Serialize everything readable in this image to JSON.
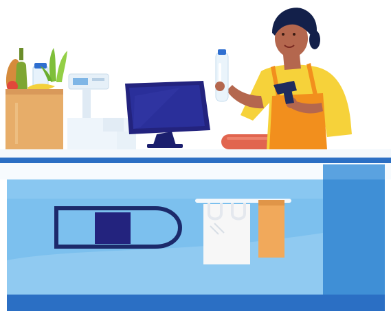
{
  "scene": {
    "subject": "cashier-at-checkout-counter",
    "colors": {
      "counter_body": "#7cc0ee",
      "counter_body_light": "#a9d6f5",
      "counter_side": "#3f8fd6",
      "counter_top": "#f3f8fc",
      "counter_edge": "#2b6fc4",
      "monitor": "#23237e",
      "monitor_screen": "#2a2f9a",
      "apron": "#f28f1d",
      "shirt": "#f6d23a",
      "skin": "#b4674e",
      "hair": "#13204a",
      "paper_bag": "#e7ad69",
      "bread": "#d58b3c",
      "milk_bottle": "#eaf4fb",
      "sausage": "#e1654f",
      "shopping_bag_white": "#f7f7f7",
      "shopping_bag_orange": "#f1a95b",
      "card_slot_frame": "#1c2a6b"
    },
    "icons": [
      "paper-grocery-bag-icon",
      "bread-icon",
      "wine-bottle-icon",
      "milk-bottle-icon",
      "banana-icon",
      "carrot-icon",
      "receipt-printer-icon",
      "cash-register-monitor-icon",
      "barcode-scanner-icon",
      "sausage-icon",
      "plastic-bag-icon",
      "paper-bag-icon",
      "card-slot-icon"
    ]
  }
}
